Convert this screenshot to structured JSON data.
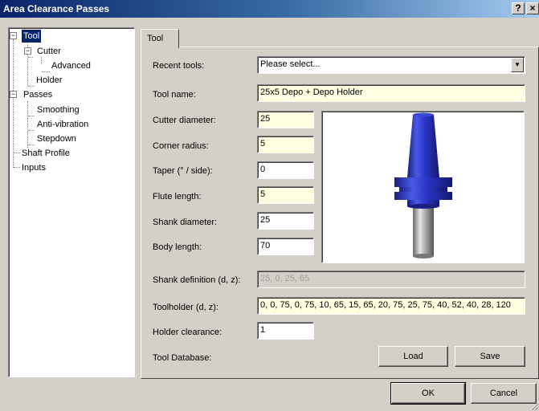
{
  "window": {
    "title": "Area Clearance Passes",
    "help_label": "?",
    "close_label": "×"
  },
  "tree": {
    "items": [
      {
        "label": "Tool",
        "selected": true
      },
      {
        "label": "Cutter"
      },
      {
        "label": "Advanced"
      },
      {
        "label": "Holder"
      },
      {
        "label": "Passes"
      },
      {
        "label": "Smoothing"
      },
      {
        "label": "Anti-vibration"
      },
      {
        "label": "Stepdown"
      },
      {
        "label": "Shaft Profile"
      },
      {
        "label": "Inputs"
      }
    ],
    "expander_minus": "−"
  },
  "tab": {
    "label": "Tool"
  },
  "form": {
    "recent_tools": {
      "label": "Recent tools:",
      "value": "Please select..."
    },
    "tool_name": {
      "label": "Tool name:",
      "value": "25x5 Depo + Depo Holder"
    },
    "cutter_diameter": {
      "label": "Cutter diameter:",
      "value": "25"
    },
    "corner_radius": {
      "label": "Corner radius:",
      "value": "5"
    },
    "taper": {
      "label": "Taper (° / side):",
      "value": "0"
    },
    "flute_length": {
      "label": "Flute length:",
      "value": "5"
    },
    "shank_diameter": {
      "label": "Shank diameter:",
      "value": "25"
    },
    "body_length": {
      "label": "Body length:",
      "value": "70"
    },
    "shank_definition": {
      "label": "Shank definition (d, z):",
      "value": "25, 0, 25, 65"
    },
    "toolholder": {
      "label": "Toolholder (d, z):",
      "value": "0, 0, 75, 0, 75, 10, 65, 15, 65, 20, 75, 25, 75, 40, 52, 40, 28, 120"
    },
    "holder_clearance": {
      "label": "Holder clearance:",
      "value": "1"
    },
    "tool_database": {
      "label": "Tool Database:"
    }
  },
  "buttons": {
    "load": "Load",
    "save": "Save",
    "ok": "OK",
    "cancel": "Cancel"
  },
  "colors": {
    "holder_blue": "#2a36c8",
    "shank_gray": "#a8a8a8",
    "field_yellow": "#ffffe1",
    "selection": "#0a246a"
  }
}
